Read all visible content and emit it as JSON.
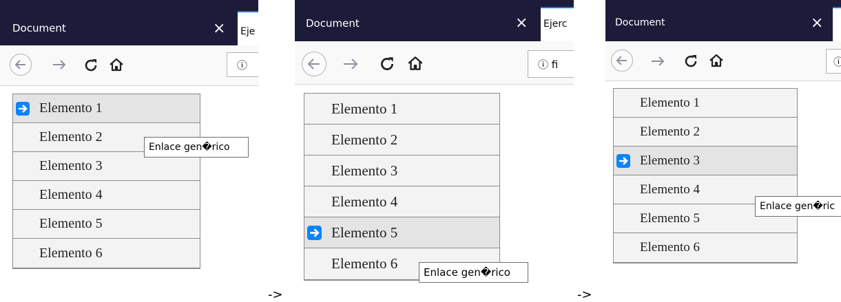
{
  "separator": "->",
  "panels": [
    {
      "tab_title": "Document",
      "next_tab_label": "Eje",
      "url_text": "",
      "menu_items": [
        "Elemento 1",
        "Elemento 2",
        "Elemento 3",
        "Elemento 4",
        "Elemento 5",
        "Elemento 6"
      ],
      "active_item": "Elemento 1",
      "tooltip": "Enlace gen�rico"
    },
    {
      "tab_title": "Document",
      "next_tab_label": "Ejerc",
      "url_text": "fi",
      "menu_items": [
        "Elemento 1",
        "Elemento 2",
        "Elemento 3",
        "Elemento 4",
        "Elemento 5",
        "Elemento 6"
      ],
      "active_item": "Elemento 5",
      "tooltip": "Enlace gen�rico"
    },
    {
      "tab_title": "Document",
      "next_tab_label": "",
      "url_text": "",
      "menu_items": [
        "Elemento 1",
        "Elemento 2",
        "Elemento 3",
        "Elemento 4",
        "Elemento 5",
        "Elemento 6"
      ],
      "active_item": "Elemento 3",
      "tooltip": "Enlace gen�ric"
    }
  ],
  "icons": {
    "close": "close-icon",
    "back": "back-arrow-icon",
    "forward": "forward-arrow-icon",
    "reload": "reload-icon",
    "home": "home-icon",
    "info": "info-icon",
    "active_marker": "right-arrow-icon"
  },
  "colors": {
    "tabbar": "#1c1c3a",
    "active_item_bg": "#e4e4e4",
    "menu_bg": "#f3f3f3",
    "active_marker": "#0a84ff"
  }
}
